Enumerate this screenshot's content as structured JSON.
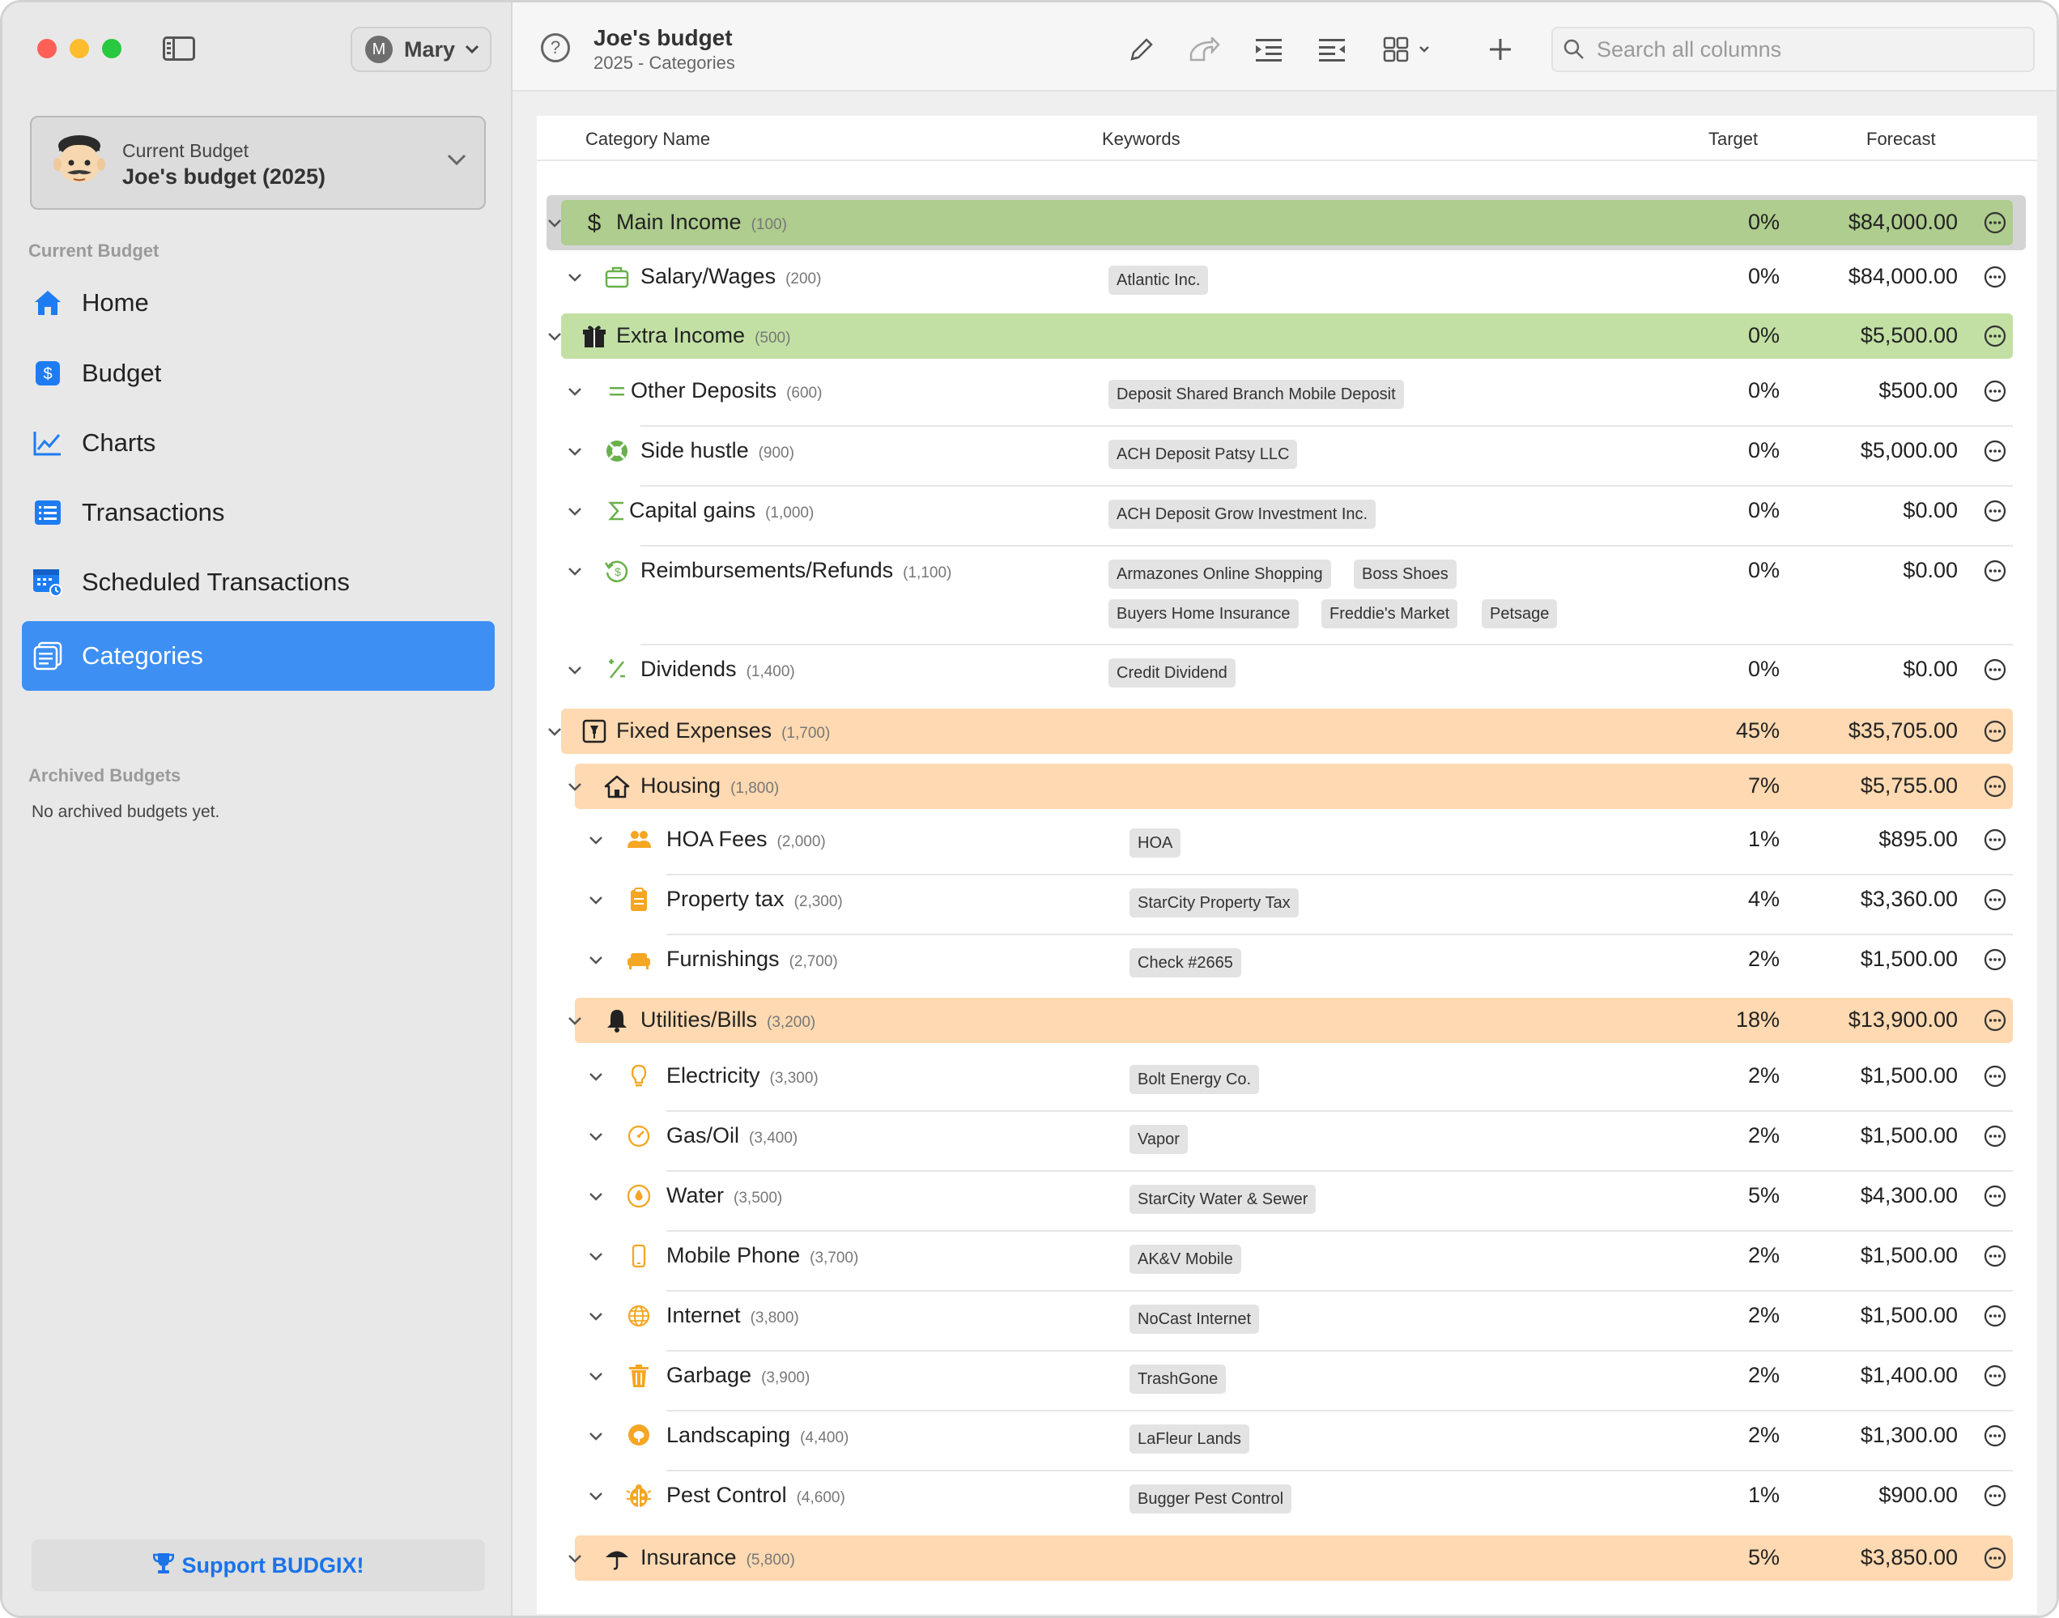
{
  "window": {
    "title": "Joe's budget",
    "subtitle": "2025 - Categories"
  },
  "sidebar": {
    "user": {
      "initial": "M",
      "name": "Mary"
    },
    "current_budget_label": "Current Budget",
    "current_budget_name": "Joe's budget (2025)",
    "section_current": "Current Budget",
    "items": [
      {
        "label": "Home",
        "icon": "house-icon"
      },
      {
        "label": "Budget",
        "icon": "dollar-square-icon"
      },
      {
        "label": "Charts",
        "icon": "line-chart-icon"
      },
      {
        "label": "Transactions",
        "icon": "list-icon"
      },
      {
        "label": "Scheduled Transactions",
        "icon": "calendar-clock-icon"
      },
      {
        "label": "Categories",
        "icon": "categories-icon",
        "active": true
      }
    ],
    "section_archived": "Archived Budgets",
    "archived_empty": "No archived budgets yet.",
    "support_label": "Support BUDGIX!"
  },
  "toolbar": {
    "search_placeholder": "Search all columns",
    "icons": [
      "pencil-icon",
      "share-arrow-icon",
      "indent-icon",
      "outdent-icon",
      "grid-view-icon",
      "plus-icon"
    ]
  },
  "table": {
    "headers": {
      "name": "Category Name",
      "keywords": "Keywords",
      "target": "Target",
      "forecast": "Forecast"
    },
    "rows": [
      {
        "name": "Main Income",
        "id": "(100)",
        "level": 0,
        "group": "income-main",
        "icon": "dollar-icon",
        "target": "0%",
        "forecast": "$84,000.00",
        "keywords": []
      },
      {
        "name": "Salary/Wages",
        "id": "(200)",
        "level": 1,
        "icon": "briefcase-icon",
        "target": "0%",
        "forecast": "$84,000.00",
        "keywords": [
          "Atlantic Inc."
        ]
      },
      {
        "name": "Extra Income",
        "id": "(500)",
        "level": 0,
        "group": "income",
        "icon": "gift-icon",
        "target": "0%",
        "forecast": "$5,500.00",
        "keywords": []
      },
      {
        "name": "Other Deposits",
        "id": "(600)",
        "level": 1,
        "icon": "equals-icon",
        "target": "0%",
        "forecast": "$500.00",
        "keywords": [
          "Deposit Shared Branch Mobile Deposit"
        ]
      },
      {
        "name": "Side hustle",
        "id": "(900)",
        "level": 1,
        "icon": "lifebuoy-icon",
        "target": "0%",
        "forecast": "$5,000.00",
        "keywords": [
          "ACH Deposit Patsy LLC"
        ]
      },
      {
        "name": "Capital gains",
        "id": "(1,000)",
        "level": 1,
        "icon": "sigma-icon",
        "target": "0%",
        "forecast": "$0.00",
        "keywords": [
          "ACH Deposit Grow Investment Inc."
        ]
      },
      {
        "name": "Reimbursements/Refunds",
        "id": "(1,100)",
        "level": 1,
        "icon": "refund-icon",
        "target": "0%",
        "forecast": "$0.00",
        "keywords": [
          "Armazones Online Shopping",
          "Boss Shoes",
          "Buyers Home Insurance",
          "Freddie's Market",
          "Petsage"
        ]
      },
      {
        "name": "Dividends",
        "id": "(1,400)",
        "level": 1,
        "icon": "plus-minus-icon",
        "target": "0%",
        "forecast": "$0.00",
        "keywords": [
          "Credit Dividend"
        ]
      },
      {
        "name": "Fixed Expenses",
        "id": "(1,700)",
        "level": 0,
        "group": "expense",
        "icon": "pin-square-icon",
        "target": "45%",
        "forecast": "$35,705.00",
        "keywords": []
      },
      {
        "name": "Housing",
        "id": "(1,800)",
        "level": 1,
        "group": "expense",
        "icon": "house-outline-icon",
        "target": "7%",
        "forecast": "$5,755.00",
        "keywords": []
      },
      {
        "name": "HOA Fees",
        "id": "(2,000)",
        "level": 2,
        "icon": "people-icon",
        "target": "1%",
        "forecast": "$895.00",
        "keywords": [
          "HOA"
        ]
      },
      {
        "name": "Property tax",
        "id": "(2,300)",
        "level": 2,
        "icon": "clipboard-icon",
        "target": "4%",
        "forecast": "$3,360.00",
        "keywords": [
          "StarCity Property Tax"
        ]
      },
      {
        "name": "Furnishings",
        "id": "(2,700)",
        "level": 2,
        "icon": "sofa-icon",
        "target": "2%",
        "forecast": "$1,500.00",
        "keywords": [
          "Check #2665"
        ]
      },
      {
        "name": "Utilities/Bills",
        "id": "(3,200)",
        "level": 1,
        "group": "expense",
        "icon": "bell-icon",
        "target": "18%",
        "forecast": "$13,900.00",
        "keywords": []
      },
      {
        "name": "Electricity",
        "id": "(3,300)",
        "level": 2,
        "icon": "lightbulb-icon",
        "target": "2%",
        "forecast": "$1,500.00",
        "keywords": [
          "Bolt Energy Co."
        ]
      },
      {
        "name": "Gas/Oil",
        "id": "(3,400)",
        "level": 2,
        "icon": "gauge-icon",
        "target": "2%",
        "forecast": "$1,500.00",
        "keywords": [
          "Vapor"
        ]
      },
      {
        "name": "Water",
        "id": "(3,500)",
        "level": 2,
        "icon": "drop-icon",
        "target": "5%",
        "forecast": "$4,300.00",
        "keywords": [
          "StarCity Water & Sewer"
        ]
      },
      {
        "name": "Mobile Phone",
        "id": "(3,700)",
        "level": 2,
        "icon": "phone-icon",
        "target": "2%",
        "forecast": "$1,500.00",
        "keywords": [
          "AK&V Mobile"
        ]
      },
      {
        "name": "Internet",
        "id": "(3,800)",
        "level": 2,
        "icon": "globe-icon",
        "target": "2%",
        "forecast": "$1,500.00",
        "keywords": [
          "NoCast Internet"
        ]
      },
      {
        "name": "Garbage",
        "id": "(3,900)",
        "level": 2,
        "icon": "trash-icon",
        "target": "2%",
        "forecast": "$1,400.00",
        "keywords": [
          "TrashGone"
        ]
      },
      {
        "name": "Landscaping",
        "id": "(4,400)",
        "level": 2,
        "icon": "tree-icon",
        "target": "2%",
        "forecast": "$1,300.00",
        "keywords": [
          "LaFleur Lands"
        ]
      },
      {
        "name": "Pest Control",
        "id": "(4,600)",
        "level": 2,
        "icon": "ladybug-icon",
        "target": "1%",
        "forecast": "$900.00",
        "keywords": [
          "Bugger Pest Control"
        ]
      },
      {
        "name": "Insurance",
        "id": "(5,800)",
        "level": 1,
        "group": "expense",
        "icon": "umbrella-icon",
        "target": "5%",
        "forecast": "$3,850.00",
        "keywords": []
      }
    ]
  },
  "colors": {
    "income_main": "#aecd8e",
    "income": "#c2e0a4",
    "expense": "#fed9b1",
    "accent": "#3d8ff3",
    "income_icon": "#6ab04c",
    "expense_icon": "#f5a623"
  }
}
